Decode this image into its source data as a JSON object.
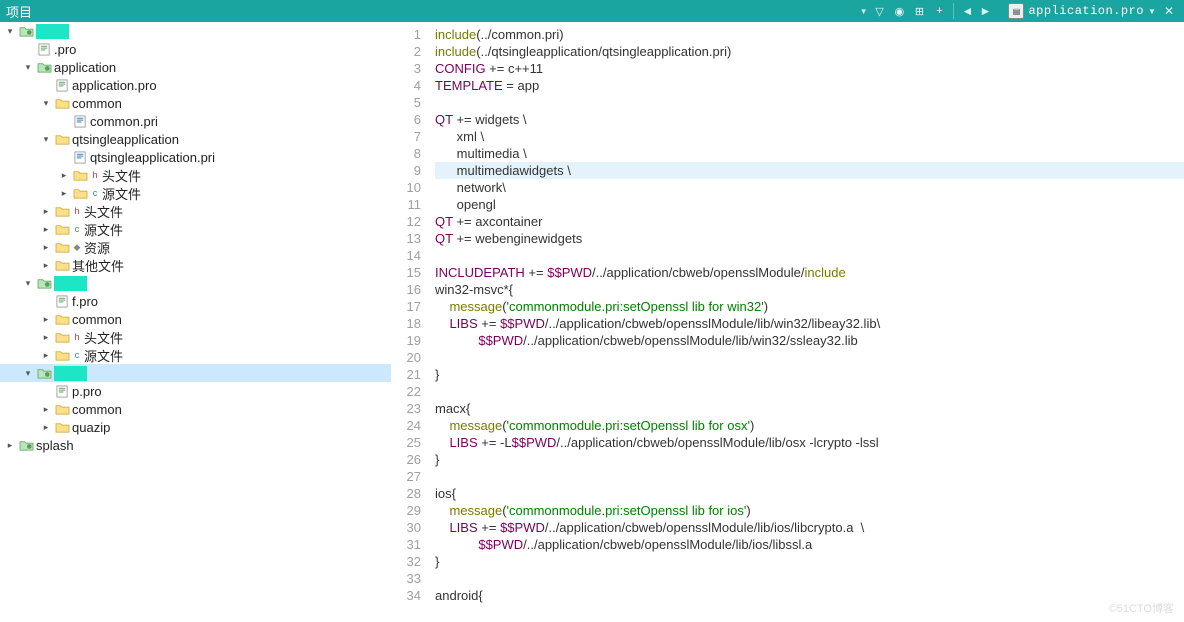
{
  "toolbar": {
    "project_label": "项目",
    "active_file": "application.pro"
  },
  "tree": [
    {
      "depth": 0,
      "exp": "open",
      "icon": "proj",
      "label": "",
      "hl": true
    },
    {
      "depth": 1,
      "exp": "none",
      "icon": "pro",
      "label": ".pro",
      "prefix": "",
      "hl": false
    },
    {
      "depth": 1,
      "exp": "open",
      "icon": "proj",
      "label": "application"
    },
    {
      "depth": 2,
      "exp": "none",
      "icon": "pro",
      "label": "application.pro"
    },
    {
      "depth": 2,
      "exp": "open",
      "icon": "folder",
      "label": "common"
    },
    {
      "depth": 3,
      "exp": "none",
      "icon": "pri",
      "label": "common.pri"
    },
    {
      "depth": 2,
      "exp": "open",
      "icon": "folder",
      "label": "qtsingleapplication"
    },
    {
      "depth": 3,
      "exp": "none",
      "icon": "pri",
      "label": "qtsingleapplication.pri"
    },
    {
      "depth": 3,
      "exp": "closed",
      "icon": "folder",
      "label": "头文件",
      "sub": "h"
    },
    {
      "depth": 3,
      "exp": "closed",
      "icon": "folder",
      "label": "源文件",
      "sub": "c"
    },
    {
      "depth": 2,
      "exp": "closed",
      "icon": "folder",
      "label": "头文件",
      "sub": "h"
    },
    {
      "depth": 2,
      "exp": "closed",
      "icon": "folder",
      "label": "源文件",
      "sub": "c"
    },
    {
      "depth": 2,
      "exp": "closed",
      "icon": "folder",
      "label": "资源",
      "sub": "r"
    },
    {
      "depth": 2,
      "exp": "closed",
      "icon": "folder",
      "label": "其他文件"
    },
    {
      "depth": 1,
      "exp": "open",
      "icon": "proj",
      "label": "",
      "hl": true
    },
    {
      "depth": 2,
      "exp": "none",
      "icon": "pro",
      "label": "f.pro",
      "prefix": ""
    },
    {
      "depth": 2,
      "exp": "closed",
      "icon": "folder",
      "label": "common"
    },
    {
      "depth": 2,
      "exp": "closed",
      "icon": "folder",
      "label": "头文件",
      "sub": "h"
    },
    {
      "depth": 2,
      "exp": "closed",
      "icon": "folder",
      "label": "源文件",
      "sub": "c"
    },
    {
      "depth": 1,
      "exp": "open",
      "icon": "proj",
      "label": "",
      "hl": true,
      "selected": true
    },
    {
      "depth": 2,
      "exp": "none",
      "icon": "pro",
      "label": "p.pro",
      "prefix": ""
    },
    {
      "depth": 2,
      "exp": "closed",
      "icon": "folder",
      "label": "common"
    },
    {
      "depth": 2,
      "exp": "closed",
      "icon": "folder",
      "label": "quazip"
    },
    {
      "depth": 0,
      "exp": "closed",
      "icon": "proj",
      "label": "splash"
    }
  ],
  "code": {
    "highlight_line": 9,
    "lines": [
      {
        "n": 1,
        "segs": [
          {
            "t": "include",
            "c": "kw"
          },
          {
            "t": "(../common.pri)"
          }
        ]
      },
      {
        "n": 2,
        "segs": [
          {
            "t": "include",
            "c": "kw"
          },
          {
            "t": "(../qtsingleapplication/qtsingleapplication.pri)"
          }
        ]
      },
      {
        "n": 3,
        "segs": [
          {
            "t": "CONFIG",
            "c": "var"
          },
          {
            "t": " += c++11"
          }
        ]
      },
      {
        "n": 4,
        "segs": [
          {
            "t": "TEMPLATE",
            "c": "var"
          },
          {
            "t": " = app"
          }
        ]
      },
      {
        "n": 5,
        "segs": []
      },
      {
        "n": 6,
        "segs": [
          {
            "t": "QT",
            "c": "var"
          },
          {
            "t": " += widgets \\"
          }
        ]
      },
      {
        "n": 7,
        "segs": [
          {
            "t": "      xml \\"
          }
        ]
      },
      {
        "n": 8,
        "segs": [
          {
            "t": "      multimedia \\"
          }
        ]
      },
      {
        "n": 9,
        "segs": [
          {
            "t": "      multimediawidgets \\"
          }
        ]
      },
      {
        "n": 10,
        "segs": [
          {
            "t": "      network\\"
          }
        ]
      },
      {
        "n": 11,
        "segs": [
          {
            "t": "      opengl"
          }
        ]
      },
      {
        "n": 12,
        "segs": [
          {
            "t": "QT",
            "c": "var"
          },
          {
            "t": " += axcontainer"
          }
        ]
      },
      {
        "n": 13,
        "segs": [
          {
            "t": "QT",
            "c": "var"
          },
          {
            "t": " += webenginewidgets"
          }
        ]
      },
      {
        "n": 14,
        "segs": []
      },
      {
        "n": 15,
        "segs": [
          {
            "t": "INCLUDEPATH",
            "c": "var"
          },
          {
            "t": " += "
          },
          {
            "t": "$$PWD",
            "c": "var"
          },
          {
            "t": "/../application/cbweb/opensslModule/"
          },
          {
            "t": "include",
            "c": "kw"
          }
        ]
      },
      {
        "n": 16,
        "segs": [
          {
            "t": "win32-msvc*{"
          }
        ]
      },
      {
        "n": 17,
        "segs": [
          {
            "t": "    "
          },
          {
            "t": "message",
            "c": "kw"
          },
          {
            "t": "("
          },
          {
            "t": "'commonmodule.pri:setOpenssl lib for win32'",
            "c": "str"
          },
          {
            "t": ")"
          }
        ]
      },
      {
        "n": 18,
        "segs": [
          {
            "t": "    "
          },
          {
            "t": "LIBS",
            "c": "var"
          },
          {
            "t": " += "
          },
          {
            "t": "$$PWD",
            "c": "var"
          },
          {
            "t": "/../application/cbweb/opensslModule/lib/win32/libeay32.lib\\"
          }
        ]
      },
      {
        "n": 19,
        "segs": [
          {
            "t": "            "
          },
          {
            "t": "$$PWD",
            "c": "var"
          },
          {
            "t": "/../application/cbweb/opensslModule/lib/win32/ssleay32.lib"
          }
        ]
      },
      {
        "n": 20,
        "segs": []
      },
      {
        "n": 21,
        "segs": [
          {
            "t": "}"
          }
        ]
      },
      {
        "n": 22,
        "segs": []
      },
      {
        "n": 23,
        "segs": [
          {
            "t": "macx{"
          }
        ]
      },
      {
        "n": 24,
        "segs": [
          {
            "t": "    "
          },
          {
            "t": "message",
            "c": "kw"
          },
          {
            "t": "("
          },
          {
            "t": "'commonmodule.pri:setOpenssl lib for osx'",
            "c": "str"
          },
          {
            "t": ")"
          }
        ]
      },
      {
        "n": 25,
        "segs": [
          {
            "t": "    "
          },
          {
            "t": "LIBS",
            "c": "var"
          },
          {
            "t": " += -L"
          },
          {
            "t": "$$PWD",
            "c": "var"
          },
          {
            "t": "/../application/cbweb/opensslModule/lib/osx -lcrypto -lssl"
          }
        ]
      },
      {
        "n": 26,
        "segs": [
          {
            "t": "}"
          }
        ]
      },
      {
        "n": 27,
        "segs": []
      },
      {
        "n": 28,
        "segs": [
          {
            "t": "ios{"
          }
        ]
      },
      {
        "n": 29,
        "segs": [
          {
            "t": "    "
          },
          {
            "t": "message",
            "c": "kw"
          },
          {
            "t": "("
          },
          {
            "t": "'commonmodule.pri:setOpenssl lib for ios'",
            "c": "str"
          },
          {
            "t": ")"
          }
        ]
      },
      {
        "n": 30,
        "segs": [
          {
            "t": "    "
          },
          {
            "t": "LIBS",
            "c": "var"
          },
          {
            "t": " += "
          },
          {
            "t": "$$PWD",
            "c": "var"
          },
          {
            "t": "/../application/cbweb/opensslModule/lib/ios/libcrypto.a  \\"
          }
        ]
      },
      {
        "n": 31,
        "segs": [
          {
            "t": "            "
          },
          {
            "t": "$$PWD",
            "c": "var"
          },
          {
            "t": "/../application/cbweb/opensslModule/lib/ios/libssl.a"
          }
        ]
      },
      {
        "n": 32,
        "segs": [
          {
            "t": "}"
          }
        ]
      },
      {
        "n": 33,
        "segs": []
      },
      {
        "n": 34,
        "segs": [
          {
            "t": "android{"
          }
        ]
      }
    ]
  },
  "watermark": "©51CTO博客"
}
